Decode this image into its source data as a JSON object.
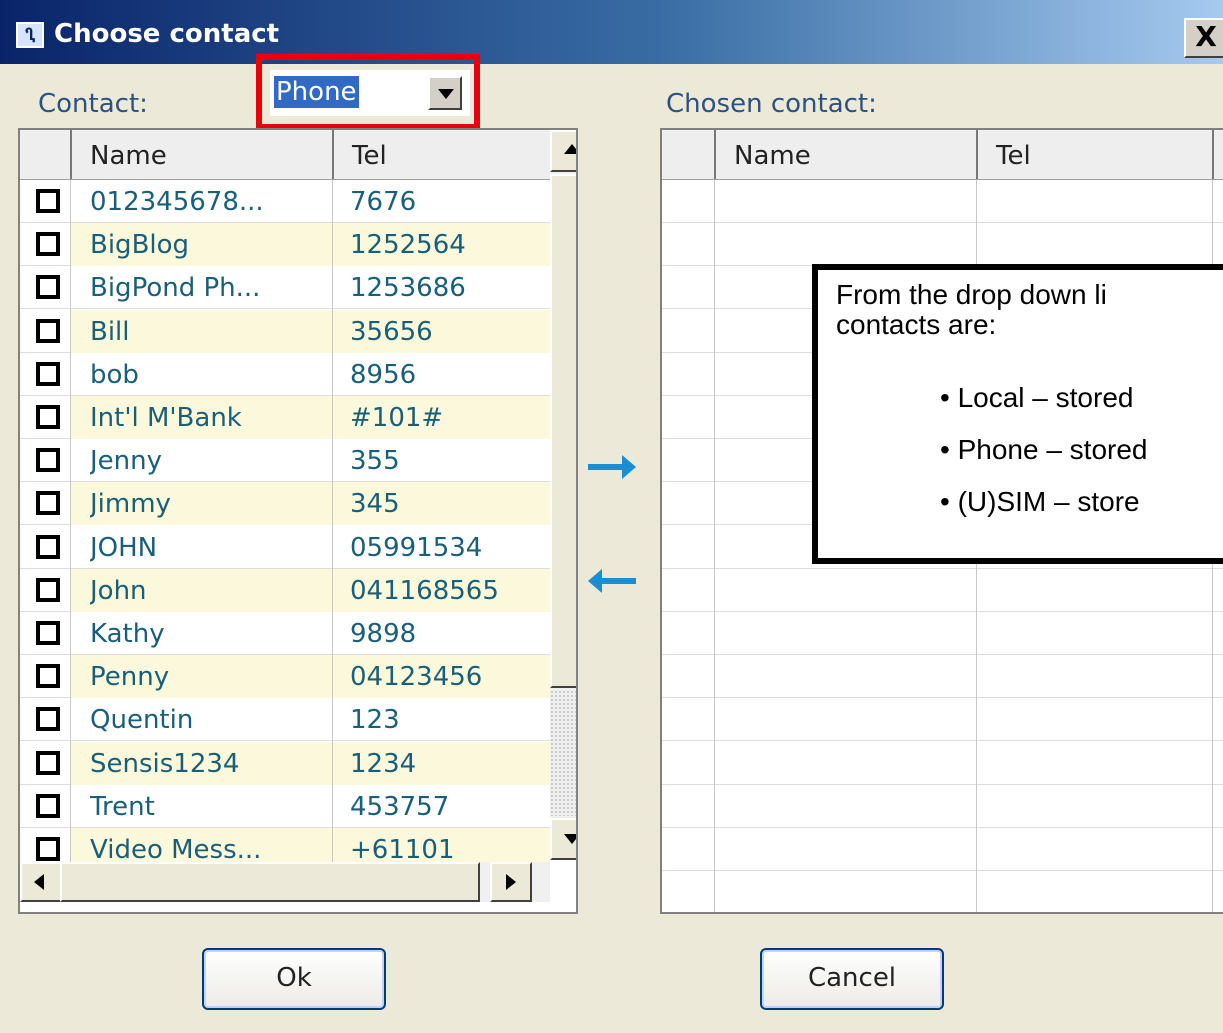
{
  "window": {
    "title": "Choose contact",
    "close_label": "X"
  },
  "left_panel": {
    "label": "Contact:",
    "source_select": {
      "selected": "Phone"
    },
    "columns": [
      "Name",
      "Tel"
    ],
    "rows": [
      {
        "name": "012345678...",
        "tel": "7676"
      },
      {
        "name": "BigBlog",
        "tel": "1252564"
      },
      {
        "name": "BigPond Ph...",
        "tel": "1253686"
      },
      {
        "name": "Bill",
        "tel": "35656"
      },
      {
        "name": "bob",
        "tel": "8956"
      },
      {
        "name": "Int'l M'Bank",
        "tel": "#101#"
      },
      {
        "name": "Jenny",
        "tel": "355"
      },
      {
        "name": "Jimmy",
        "tel": "345"
      },
      {
        "name": "JOHN",
        "tel": "05991534"
      },
      {
        "name": "John",
        "tel": "041168565"
      },
      {
        "name": "Kathy",
        "tel": "9898"
      },
      {
        "name": "Penny",
        "tel": "04123456"
      },
      {
        "name": "Quentin",
        "tel": "123"
      },
      {
        "name": "Sensis1234",
        "tel": "1234"
      },
      {
        "name": "Trent",
        "tel": "453757"
      },
      {
        "name": "Video Mess...",
        "tel": "+61101"
      }
    ]
  },
  "right_panel": {
    "label": "Chosen contact:",
    "columns": [
      "Name",
      "Tel"
    ]
  },
  "callout": {
    "intro": "From the drop down li",
    "intro_line2": "contacts are:",
    "bullets": [
      "• Local – stored",
      "• Phone – stored",
      "• (U)SIM – store"
    ]
  },
  "buttons": {
    "ok": "Ok",
    "cancel": "Cancel"
  },
  "colors": {
    "highlight": "#e8000b",
    "arrow": "#1a8ed1",
    "name_text": "#1a5f7a"
  }
}
